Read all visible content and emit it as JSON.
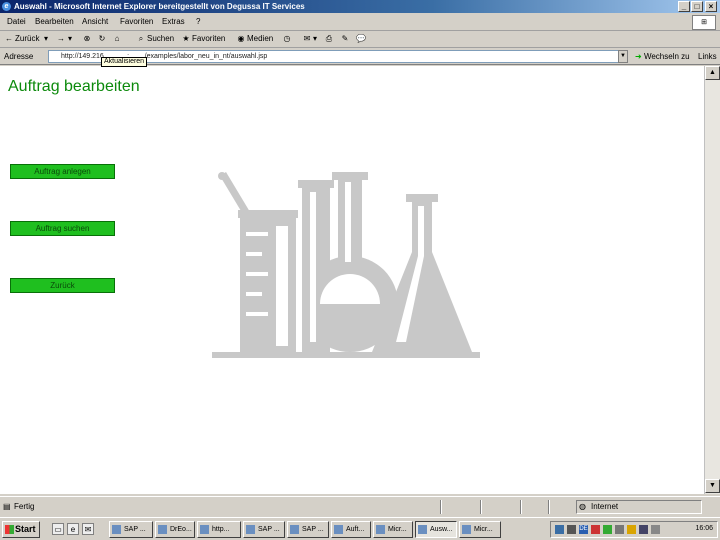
{
  "window": {
    "title": "Auswahl - Microsoft Internet Explorer bereitgestellt von Degussa IT Services"
  },
  "menubar": {
    "items": [
      "Datei",
      "Bearbeiten",
      "Ansicht",
      "Favoriten",
      "Extras",
      "?"
    ]
  },
  "toolbar": {
    "back_label": "Zurück",
    "search_label": "Suchen",
    "favorites_label": "Favoriten",
    "media_label": "Medien"
  },
  "addressbar": {
    "label": "Adresse",
    "url": "http://149.216.___.__:____/examples/labor_neu_in_nt/auswahl.jsp",
    "tooltip": "Aktualisieren",
    "go_label": "Wechseln zu",
    "links_label": "Links"
  },
  "page": {
    "title": "Auftrag bearbeiten",
    "buttons": [
      "Auftrag anlegen",
      "Auftrag suchen",
      "Zurück"
    ]
  },
  "statusbar": {
    "left": "Fertig",
    "zone": "Internet"
  },
  "taskbar": {
    "start_label": "Start",
    "tasks": [
      "SAP ...",
      "DrEo...",
      "http...",
      "SAP ...",
      "SAP ...",
      "Auft...",
      "Micr...",
      "Ausw...",
      "Micr..."
    ],
    "clock": "16:06"
  }
}
